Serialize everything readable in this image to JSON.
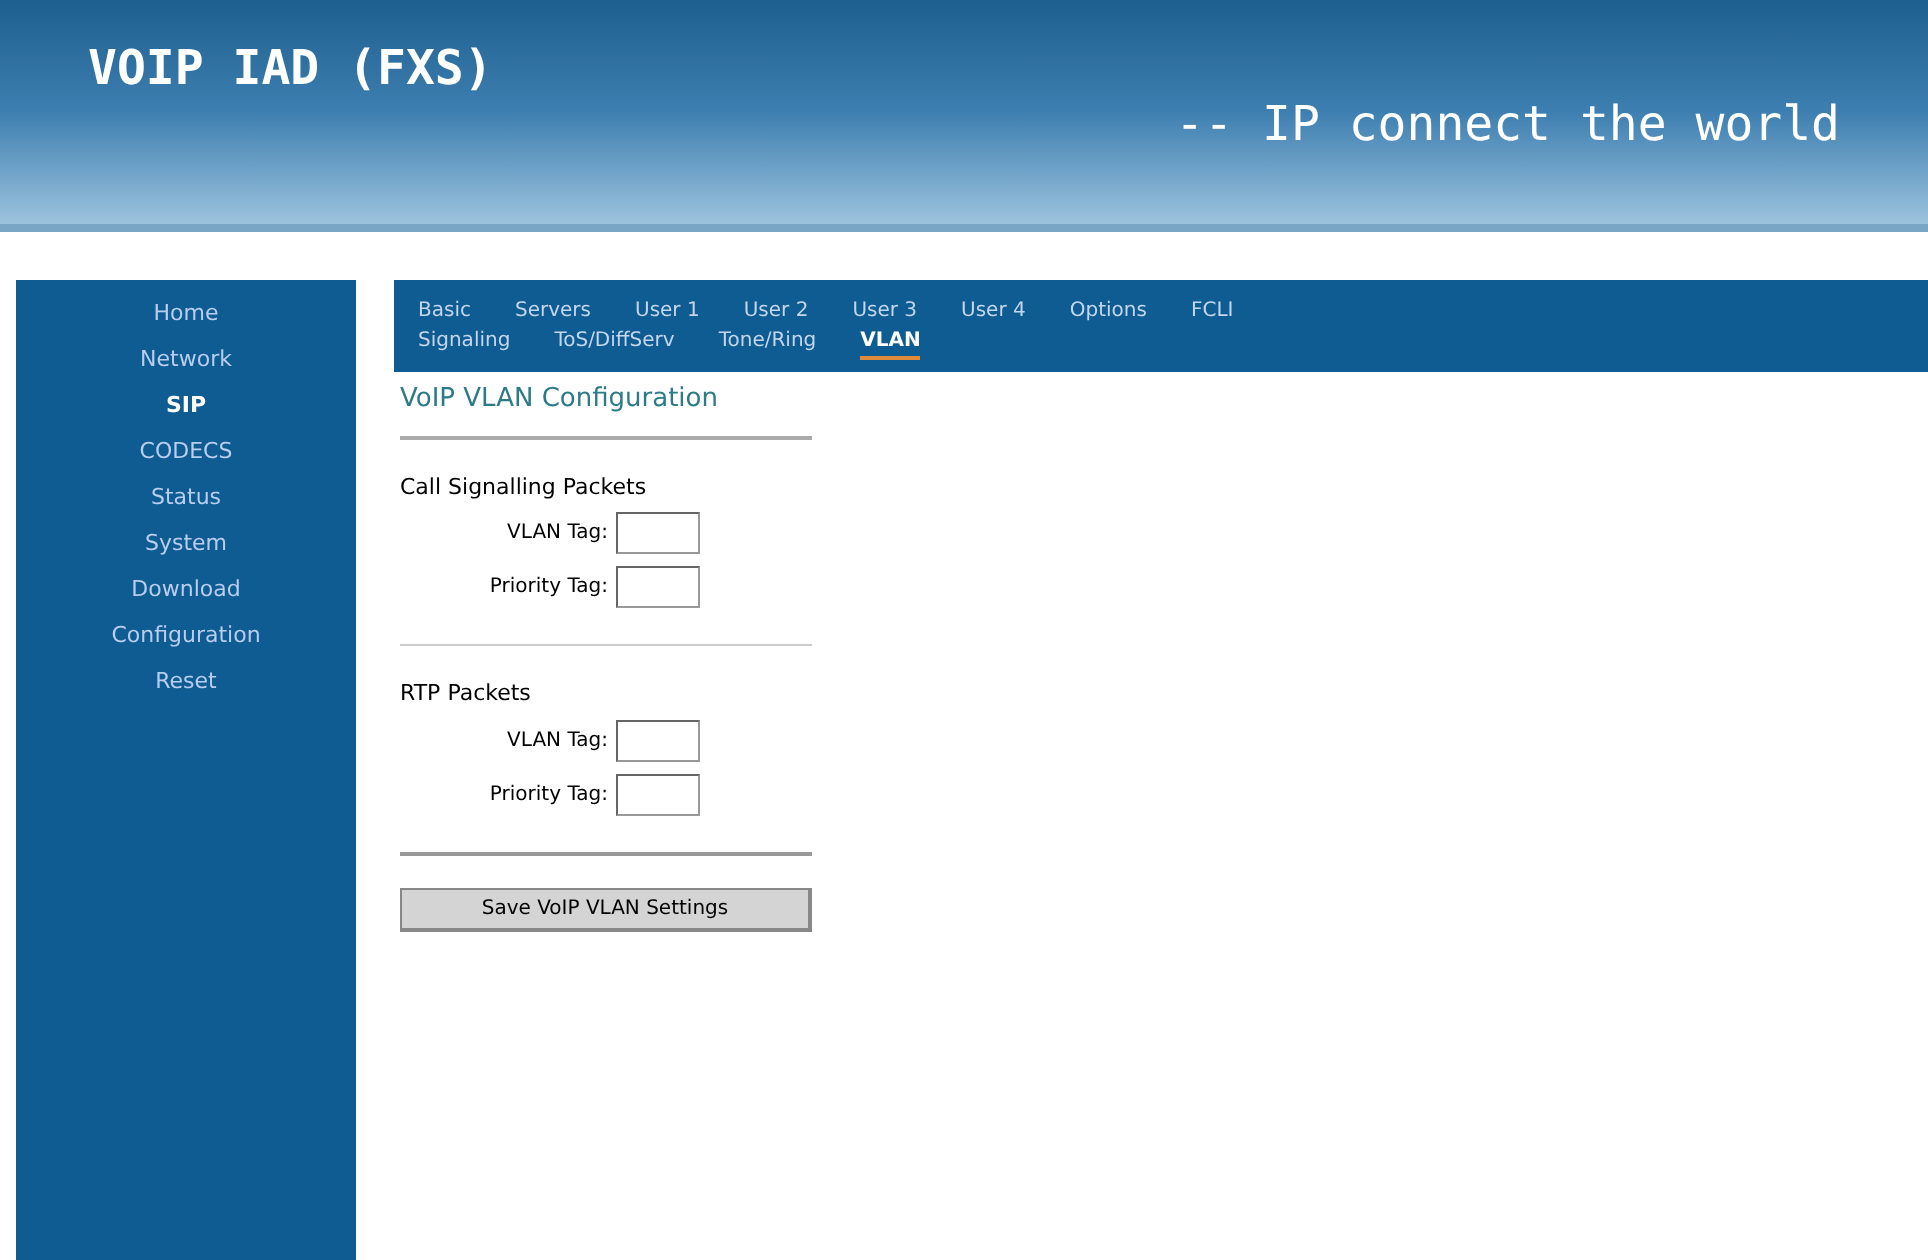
{
  "header": {
    "title": "VOIP IAD (FXS)",
    "slogan": "-- IP connect the world"
  },
  "sidebar": {
    "items": [
      {
        "label": "Home",
        "selected": false
      },
      {
        "label": "Network",
        "selected": false
      },
      {
        "label": "SIP",
        "selected": true
      },
      {
        "label": "CODECS",
        "selected": false
      },
      {
        "label": "Status",
        "selected": false
      },
      {
        "label": "System",
        "selected": false
      },
      {
        "label": "Download",
        "selected": false
      },
      {
        "label": "Configuration",
        "selected": false
      },
      {
        "label": "Reset",
        "selected": false
      }
    ]
  },
  "tabs": [
    [
      {
        "label": "Basic",
        "selected": false
      },
      {
        "label": "Servers",
        "selected": false
      },
      {
        "label": "User 1",
        "selected": false
      },
      {
        "label": "User 2",
        "selected": false
      },
      {
        "label": "User 3",
        "selected": false
      },
      {
        "label": "User 4",
        "selected": false
      },
      {
        "label": "Options",
        "selected": false
      },
      {
        "label": "FCLI",
        "selected": false
      }
    ],
    [
      {
        "label": "Signaling",
        "selected": false
      },
      {
        "label": "ToS/DiffServ",
        "selected": false
      },
      {
        "label": "Tone/Ring",
        "selected": false
      },
      {
        "label": "VLAN",
        "selected": true
      }
    ]
  ],
  "page_title": "VoIP VLAN Configuration",
  "sections": [
    {
      "title": "Call Signalling Packets",
      "fields": [
        {
          "label": "VLAN Tag:"
        },
        {
          "label": "Priority Tag:"
        }
      ]
    },
    {
      "title": "RTP Packets",
      "fields": [
        {
          "label": "VLAN Tag:"
        },
        {
          "label": "Priority Tag:"
        }
      ]
    }
  ],
  "save_button": "Save VoIP VLAN Settings"
}
